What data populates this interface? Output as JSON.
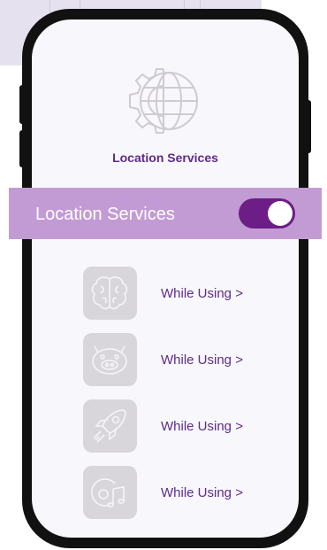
{
  "header": {
    "title": "Location Services"
  },
  "toggle": {
    "label": "Location Services",
    "state": "on",
    "accent_color": "#6c1d86",
    "bar_color": "#c39bd4"
  },
  "apps": [
    {
      "icon": "brain-icon",
      "status": "While Using >"
    },
    {
      "icon": "robot-face-icon",
      "status": "While Using >"
    },
    {
      "icon": "rocket-icon",
      "status": "While Using >"
    },
    {
      "icon": "music-disc-icon",
      "status": "While Using >"
    }
  ],
  "colors": {
    "title": "#5d2c87",
    "tile": "#d9d6db",
    "screen": "#f8f7fb"
  }
}
